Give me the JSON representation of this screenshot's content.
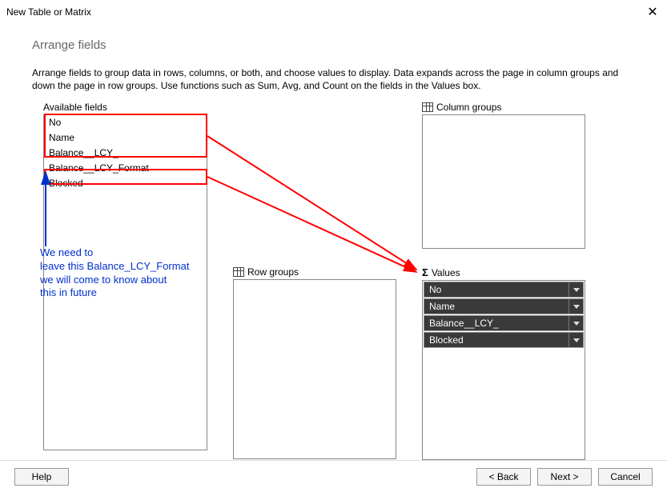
{
  "titlebar": {
    "title": "New Table or Matrix"
  },
  "subtitle": "Arrange fields",
  "description": "Arrange fields to group data in rows, columns, or both, and choose values to display. Data expands across the page in column groups and down the page in row groups.  Use functions such as Sum, Avg, and Count on the fields in the Values box.",
  "available": {
    "label": "Available fields",
    "items": [
      "No",
      "Name",
      "Balance__LCY_",
      "Balance__LCY_Format",
      "Blocked"
    ]
  },
  "colgroups": {
    "label": "Column groups"
  },
  "rowgroups": {
    "label": "Row groups"
  },
  "values": {
    "label": "Values",
    "items": [
      "No",
      "Name",
      "Balance__LCY_",
      "Blocked"
    ]
  },
  "annotation": "We need to\nleave this Balance_LCY_Format\nwe will come to know about\nthis in future",
  "footer": {
    "help": "Help",
    "back": "< Back",
    "next": "Next >",
    "cancel": "Cancel"
  }
}
